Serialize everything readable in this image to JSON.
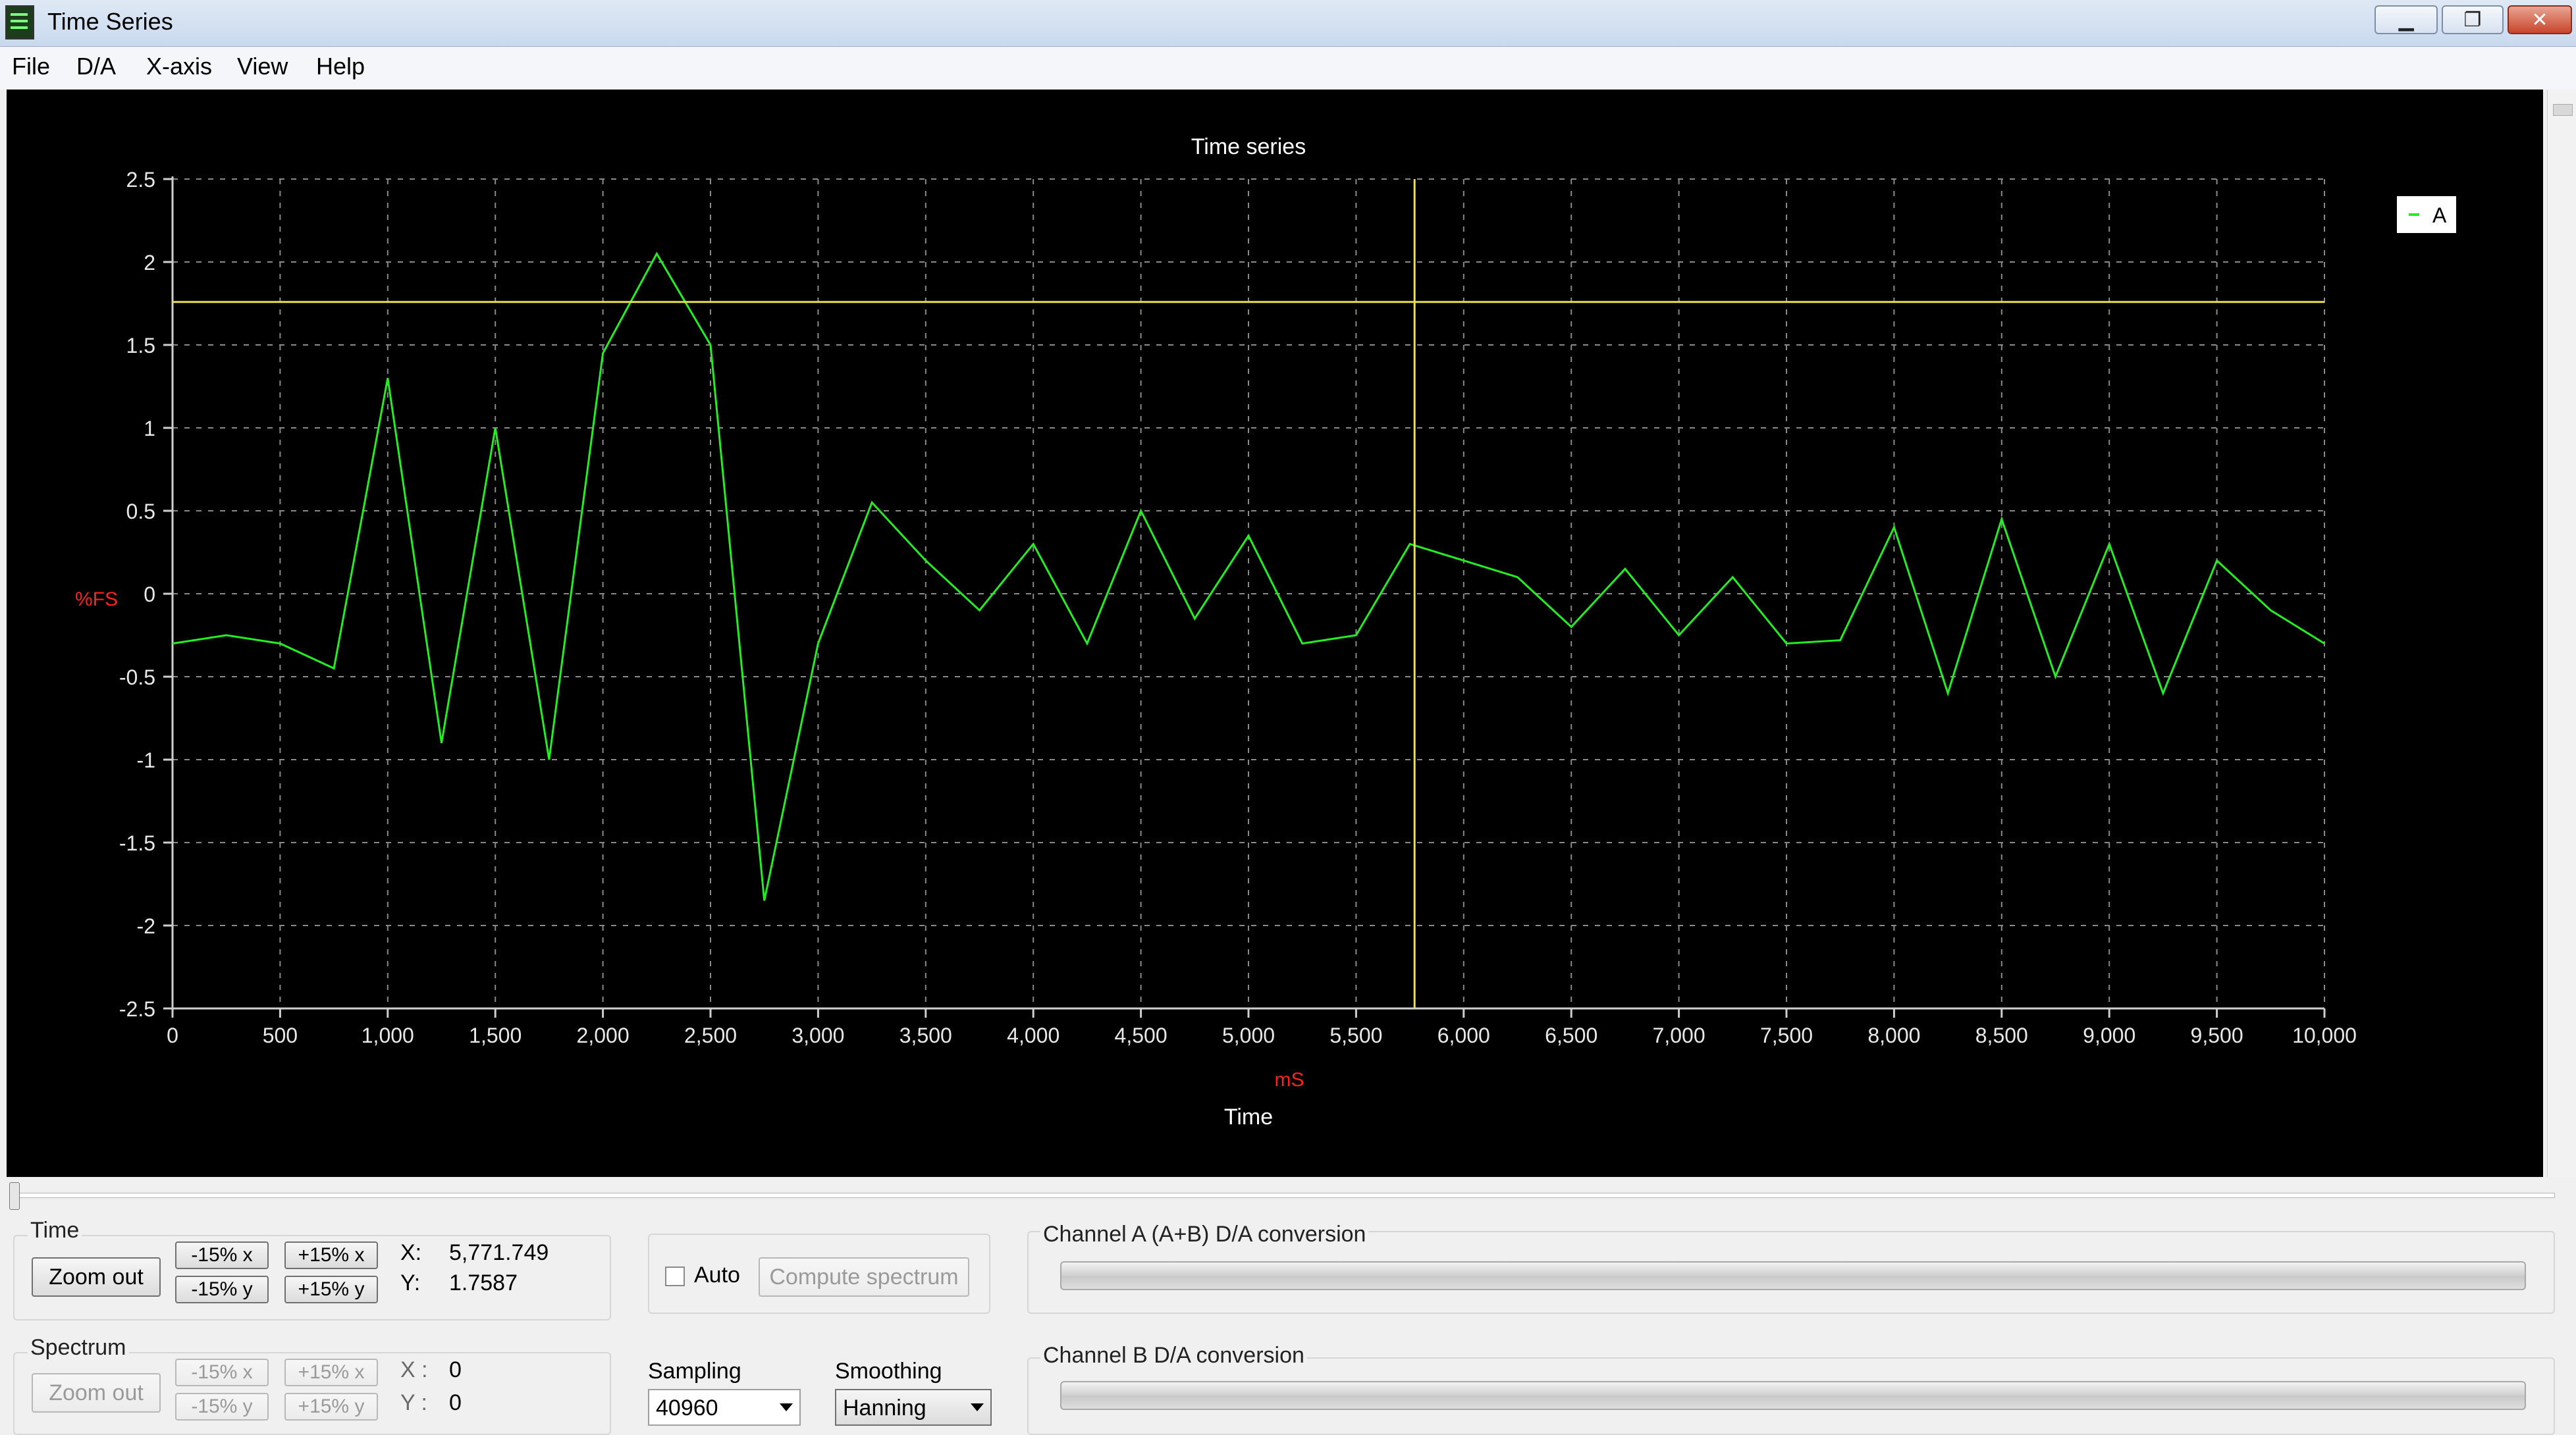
{
  "window": {
    "title": "Time Series",
    "controls": {
      "minimize_icon": "minimize-icon",
      "restore_icon": "restore-icon",
      "close_icon": "close-icon"
    }
  },
  "menu": [
    "File",
    "D/A",
    "X-axis",
    "View",
    "Help"
  ],
  "chart_data": {
    "type": "line",
    "title": "Time series",
    "xlabel": "Time",
    "xunit": "mS",
    "ylabel": "%FS",
    "xlim": [
      0,
      10000
    ],
    "ylim": [
      -2.5,
      2.5
    ],
    "x_ticks": [
      "0",
      "500",
      "1,000",
      "1,500",
      "2,000",
      "2,500",
      "3,000",
      "3,500",
      "4,000",
      "4,500",
      "5,000",
      "5,500",
      "6,000",
      "6,500",
      "7,000",
      "7,500",
      "8,000",
      "8,500",
      "9,000",
      "9,500",
      "10,000"
    ],
    "y_ticks": [
      "2.5",
      "2",
      "1.5",
      "1",
      "0.5",
      "0",
      "-0.5",
      "-1",
      "-1.5",
      "-2",
      "-2.5"
    ],
    "grid": true,
    "legend_position": "top-right",
    "series": [
      {
        "name": "A",
        "color": "#22ee22",
        "x": [
          0,
          250,
          500,
          750,
          1000,
          1250,
          1500,
          1750,
          2000,
          2250,
          2500,
          2750,
          3000,
          3250,
          3500,
          3750,
          4000,
          4250,
          4500,
          4750,
          5000,
          5250,
          5500,
          5750,
          6000,
          6250,
          6500,
          6750,
          7000,
          7250,
          7500,
          7750,
          8000,
          8250,
          8500,
          8750,
          9000,
          9250,
          9500,
          9750,
          10000
        ],
        "y": [
          -0.3,
          -0.25,
          -0.3,
          -0.45,
          1.3,
          -0.9,
          1.0,
          -1.0,
          1.45,
          2.05,
          1.5,
          -1.85,
          -0.3,
          0.55,
          0.2,
          -0.1,
          0.3,
          -0.3,
          0.5,
          -0.15,
          0.35,
          -0.3,
          -0.25,
          0.3,
          0.2,
          0.1,
          -0.2,
          0.15,
          -0.25,
          0.1,
          -0.3,
          -0.28,
          0.4,
          -0.6,
          0.45,
          -0.5,
          0.3,
          -0.6,
          0.2,
          -0.1,
          -0.3
        ]
      }
    ],
    "cursor": {
      "x": 5771.749,
      "y": 1.7587,
      "color": "#e8e04a"
    }
  },
  "bottom": {
    "time": {
      "label": "Time",
      "zoom_out": "Zoom out",
      "minus_x": "-15% x",
      "plus_x": "+15% x",
      "minus_y": "-15% y",
      "plus_y": "+15% y",
      "x_label": "X:",
      "y_label": "Y:",
      "x_value": "5,771.749",
      "y_value": "1.7587"
    },
    "spectrum": {
      "label": "Spectrum",
      "zoom_out": "Zoom out",
      "minus_x": "-15% x",
      "plus_x": "+15% x",
      "minus_y": "-15% y",
      "plus_y": "+15% y",
      "x_label": "X :",
      "y_label": "Y :",
      "x_value": "0",
      "y_value": "0"
    },
    "auto_label": "Auto",
    "compute_spectrum": "Compute spectrum",
    "sampling_label": "Sampling",
    "sampling_value": "40960",
    "smoothing_label": "Smoothing",
    "smoothing_value": "Hanning",
    "channel_a_label": "Channel A (A+B) D/A conversion",
    "channel_b_label": "Channel B D/A conversion"
  }
}
